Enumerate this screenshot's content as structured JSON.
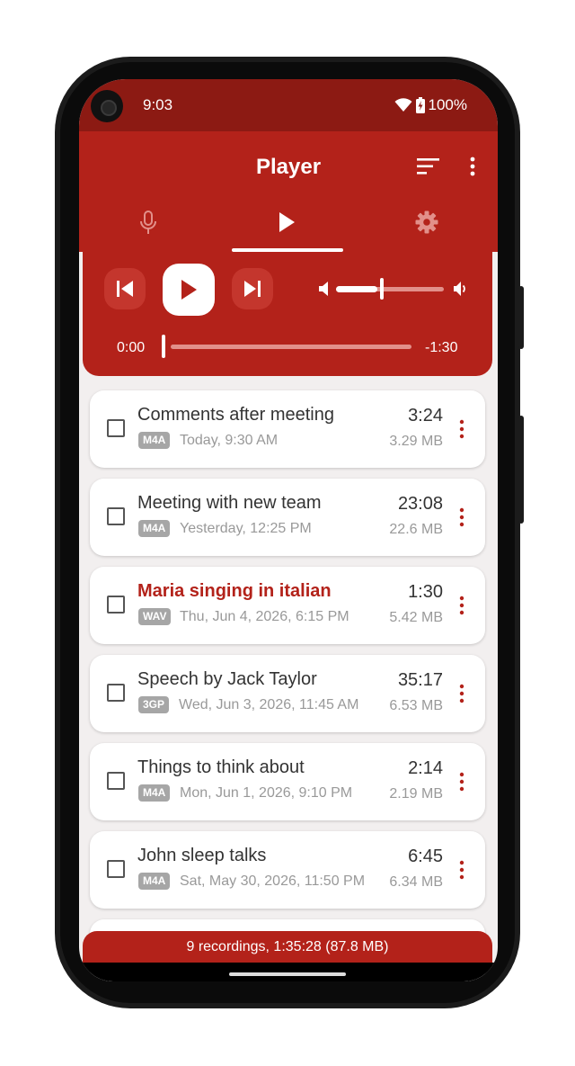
{
  "status": {
    "time": "9:03",
    "battery": "100%"
  },
  "app": {
    "title": "Player"
  },
  "tabs": [
    {
      "icon": "mic-icon"
    },
    {
      "icon": "play-icon",
      "selected": true
    },
    {
      "icon": "gear-icon"
    }
  ],
  "player": {
    "position": "0:00",
    "remaining": "-1:30",
    "volume_fraction": 0.38,
    "seek_fraction": 0.0
  },
  "recordings": [
    {
      "title": "Comments after meeting",
      "format": "M4A",
      "date": "Today, 9:30 AM",
      "duration": "3:24",
      "size": "3.29 MB",
      "active": false
    },
    {
      "title": "Meeting with new team",
      "format": "M4A",
      "date": "Yesterday, 12:25 PM",
      "duration": "23:08",
      "size": "22.6 MB",
      "active": false
    },
    {
      "title": "Maria singing in italian",
      "format": "WAV",
      "date": "Thu, Jun 4, 2026, 6:15 PM",
      "duration": "1:30",
      "size": "5.42 MB",
      "active": true
    },
    {
      "title": "Speech by Jack Taylor",
      "format": "3GP",
      "date": "Wed, Jun 3, 2026, 11:45 AM",
      "duration": "35:17",
      "size": "6.53 MB",
      "active": false
    },
    {
      "title": "Things to think about",
      "format": "M4A",
      "date": "Mon, Jun 1, 2026, 9:10 PM",
      "duration": "2:14",
      "size": "2.19 MB",
      "active": false
    },
    {
      "title": "John sleep talks",
      "format": "M4A",
      "date": "Sat, May 30, 2026, 11:50 PM",
      "duration": "6:45",
      "size": "6.34 MB",
      "active": false
    }
  ],
  "footer": {
    "summary": "9 recordings, 1:35:28 (87.8 MB)"
  },
  "colors": {
    "primary": "#b3221a",
    "status_bar": "#8c1a13",
    "background": "#f2efef"
  }
}
